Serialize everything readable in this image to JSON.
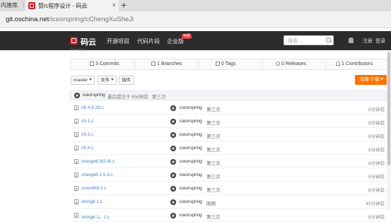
{
  "browser": {
    "prev_tab_title": "内建库.",
    "active_tab_title": "赞/c程序设计 - 码云",
    "close_glyph": "×",
    "new_tab_glyph": "+",
    "address_host": "git.oschina.net",
    "address_path": "/iceorspring/cChengXuSheJi"
  },
  "nav": {
    "logo_text": "码云",
    "items": [
      "开源项目",
      "代码片段",
      "企业版"
    ],
    "badge": "特惠",
    "search_placeholder": "搜索...",
    "register": "注册",
    "login": "登录"
  },
  "repo": {
    "cut_description": "赞/c程序"
  },
  "stats": {
    "commits": "3 Commits",
    "branches": "1 Branches",
    "tags": "0 Tags",
    "releases": "0 Releases",
    "contributors": "1 Contributors"
  },
  "toolbar": {
    "branch": "master",
    "files": "文件",
    "plugins": "插件",
    "clone": "克隆/下载"
  },
  "commit": {
    "author": "iceorspring",
    "info": "最后提交于 8分钟前 . 第三次"
  },
  "files": [
    {
      "name": "c8.4.5.29.c",
      "author": "iceorspring",
      "message": "第三次",
      "time": "8分钟前"
    },
    {
      "name": "c9.1.c",
      "author": "iceorspring",
      "message": "第三次",
      "time": "8分钟前"
    },
    {
      "name": "c9.3.c",
      "author": "iceorspring",
      "message": "第三次",
      "time": "8分钟前"
    },
    {
      "name": "c9.4.c",
      "author": "iceorspring",
      "message": "第三次",
      "time": "8分钟前"
    },
    {
      "name": "charge8.3(5.9).c",
      "author": "iceorspring",
      "message": "第三次",
      "time": "8分钟前"
    },
    {
      "name": "charge8.3.5.9.c",
      "author": "iceorspring",
      "message": "第三次",
      "time": "8分钟前"
    },
    {
      "name": "cmonth9.2.c",
      "author": "iceorspring",
      "message": "第三次",
      "time": "8分钟前"
    },
    {
      "name": "string8.1.c",
      "author": "iceorspring",
      "message": "刚刚",
      "time": "43分钟前"
    },
    {
      "name": "string8.1。1.c",
      "author": "iceorspring",
      "message": "第三次",
      "time": "8分钟前"
    }
  ],
  "colors": {
    "nav_bg": "#2c2c2c",
    "brand_red": "#c71d23",
    "clone_orange": "#fe7300",
    "link_blue": "#4183c4"
  }
}
